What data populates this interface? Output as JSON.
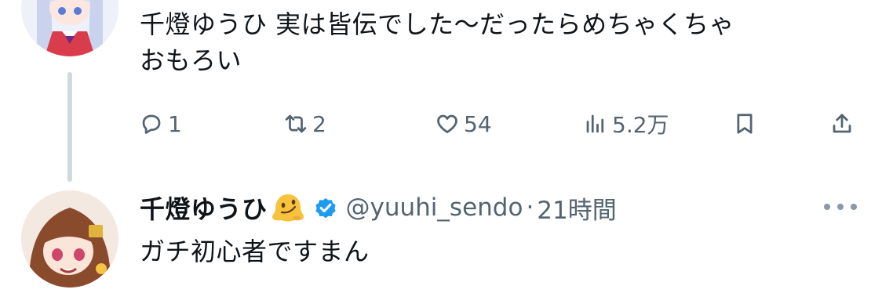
{
  "previous_tweet": {
    "text": "千燈ゆうひ 実は皆伝でした〜だったらめちゃくちゃ\nおもろい",
    "actions": {
      "reply_count": "1",
      "retweet_count": "2",
      "like_count": "54",
      "view_count": "5.2万"
    },
    "icons": [
      "reply-icon",
      "retweet-icon",
      "like-icon",
      "views-icon",
      "bookmark-icon",
      "share-icon"
    ]
  },
  "reply_tweet": {
    "author_name": "千燈ゆうひ",
    "author_emoji": "melting-face-emoji",
    "verified": true,
    "handle": "@yuuhi_sendo",
    "separator": "·",
    "time": "21時間",
    "text": "ガチ初心者ですまん"
  },
  "colors": {
    "text": "#0f1419",
    "secondary": "#536471",
    "verified_blue": "#1d9bf0",
    "thread_line": "#cfd9de"
  }
}
